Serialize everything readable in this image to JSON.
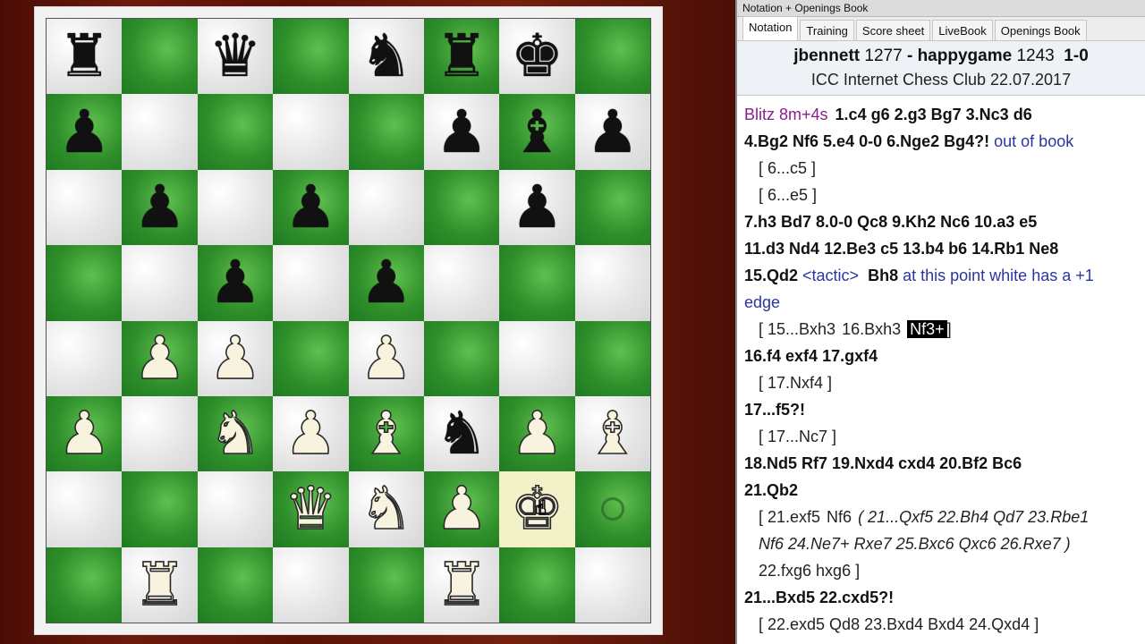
{
  "window": {
    "title": "Notation + Openings Book"
  },
  "tabs": [
    "Notation",
    "Training",
    "Score sheet",
    "LiveBook",
    "Openings Book"
  ],
  "active_tab": "Notation",
  "game": {
    "white": "jbennett",
    "white_elo": "1277",
    "black": "happygame",
    "black_elo": "1243",
    "result": "1-0",
    "event": "ICC Internet Chess Club 22.07.2017"
  },
  "board": {
    "ranks": [
      [
        "br",
        "",
        "bq",
        "",
        "bn",
        "br",
        "bk",
        ""
      ],
      [
        "bp",
        "",
        "",
        "",
        "",
        "bp",
        "bb",
        "bp"
      ],
      [
        "",
        "bp",
        "",
        "bp",
        "",
        "",
        "bp",
        ""
      ],
      [
        "",
        "",
        "bp",
        "",
        "bp",
        "",
        "",
        ""
      ],
      [
        "",
        "wp",
        "wp",
        "",
        "wp",
        "",
        "",
        ""
      ],
      [
        "wp",
        "",
        "wn",
        "wp",
        "wb",
        "bn",
        "wp",
        "wb"
      ],
      [
        "",
        "",
        "",
        "wq",
        "wn",
        "wp",
        "wk",
        ""
      ],
      [
        "",
        "wr",
        "",
        "",
        "",
        "wr",
        "",
        ""
      ]
    ],
    "highlight": "g2",
    "target_ring": "h2"
  },
  "notation": {
    "l1_event": "Blitz 8m+4s",
    "l1_moves": [
      "1.c4",
      "g6",
      "2.g3",
      "Bg7",
      "3.Nc3",
      "d6"
    ],
    "l2_moves": [
      "4.Bg2",
      "Nf6",
      "5.e4",
      "0-0",
      "6.Nge2",
      "Bg4?!"
    ],
    "l2_comment": "out of book",
    "l3_var": "[ 6...c5 ]",
    "l4_var": "[ 6...e5 ]",
    "l5_moves": [
      "7.h3",
      "Bd7",
      "8.0-0",
      "Qc8",
      "9.Kh2",
      "Nc6",
      "10.a3",
      "e5"
    ],
    "l6_moves": [
      "11.d3",
      "Nd4",
      "12.Be3",
      "c5",
      "13.b4",
      "b6",
      "14.Rb1",
      "Ne8"
    ],
    "l7_move": "15.Qd2",
    "l7_tag": "<tactic>",
    "l7_move2": "Bh8",
    "l7_comment": "at this point white has a +1",
    "l8_comment": "edge",
    "l9_open": "[ 15...Bxh3",
    "l9_m2": "16.Bxh3",
    "l9_sel": "Nf3+",
    "l9_close": "]",
    "l10_moves": [
      "16.f4",
      "exf4",
      "17.gxf4"
    ],
    "l11_var": "[ 17.Nxf4 ]",
    "l12_move": "17...f5?!",
    "l13_var": "[ 17...Nc7 ]",
    "l14_moves": [
      "18.Nd5",
      "Rf7",
      "19.Nxd4",
      "cxd4",
      "20.Bf2",
      "Bc6"
    ],
    "l15_move": "21.Qb2",
    "l16_a": "[ 21.exf5",
    "l16_b": "Nf6",
    "l16_it": "( 21...Qxf5  22.Bh4  Qd7  23.Rbe1",
    "l17_it": "Nf6  24.Ne7+  Rxe7  25.Bxc6  Qxc6  26.Rxe7 )",
    "l18_var": "22.fxg6  hxg6 ]",
    "l19_moves": [
      "21...Bxd5",
      "22.cxd5?!"
    ],
    "l20_var": "[ 22.exd5  Qd8  23.Bxd4  Bxd4  24.Qxd4 ]"
  }
}
